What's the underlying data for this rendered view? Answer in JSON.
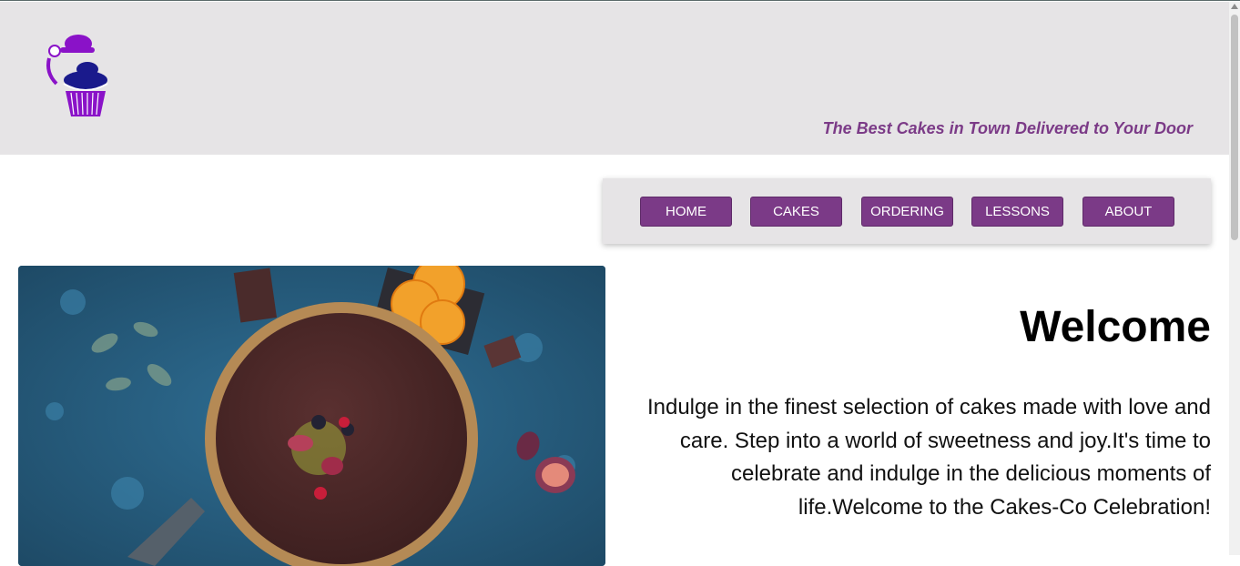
{
  "header": {
    "logo_name": "cupcake-chef-logo",
    "tagline": "The Best Cakes in Town Delivered to Your Door"
  },
  "nav": {
    "items": [
      {
        "label": "HOME"
      },
      {
        "label": "CAKES"
      },
      {
        "label": "ORDERING"
      },
      {
        "label": "LESSONS"
      },
      {
        "label": "ABOUT"
      }
    ]
  },
  "main": {
    "heading": "Welcome",
    "intro": "Indulge in the finest selection of cakes made with love and care. Step into a world of sweetness and joy.It's time to celebrate and indulge in the delicious moments of life.Welcome to the Cakes-Co Celebration!",
    "hero_image": "chocolate-tart-photo"
  },
  "colors": {
    "brand": "#7b3a87",
    "header_bg": "#e6e4e6",
    "logo_purple": "#8a12c8",
    "logo_navy": "#1a1a8c"
  }
}
